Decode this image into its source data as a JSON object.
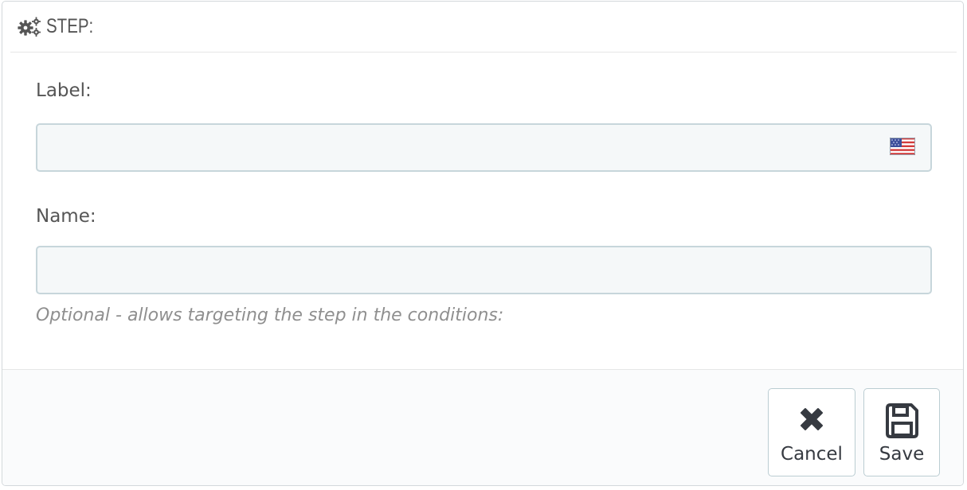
{
  "panel": {
    "title": "STEP:",
    "title_icon": "cogs-icon"
  },
  "form": {
    "label_field": {
      "label": "Label:",
      "value": "",
      "language_flag": "us-flag-icon"
    },
    "name_field": {
      "label": "Name:",
      "value": "",
      "help": "Optional - allows targeting the step in the conditions:"
    }
  },
  "footer": {
    "cancel_label": "Cancel",
    "cancel_icon": "close-icon",
    "save_label": "Save",
    "save_icon": "save-icon"
  },
  "colors": {
    "text": "#555555",
    "input_background": "#f5f8f9",
    "input_border": "#c7d6db",
    "help_text": "#8f8f8f",
    "button_border": "#bbcdd2",
    "button_text": "#363a41"
  }
}
